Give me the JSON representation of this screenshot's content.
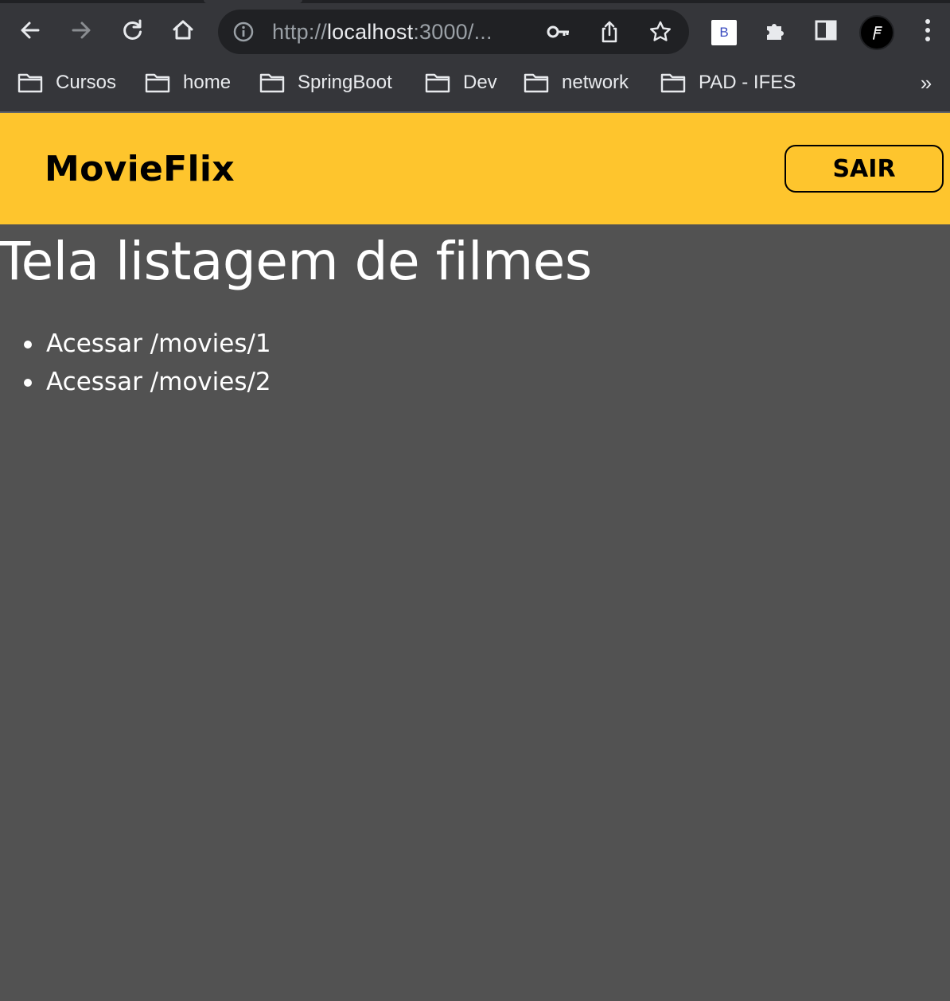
{
  "browser": {
    "url_prefix": "http://",
    "url_host": "localhost",
    "url_rest": ":3000/...",
    "extension_label": "B",
    "icons": {
      "back": "arrow-left-icon",
      "forward": "arrow-right-icon",
      "reload": "reload-icon",
      "home": "home-icon",
      "site_info": "info-icon",
      "password": "key-icon",
      "share": "share-icon",
      "bookmark": "star-icon",
      "extensions": "puzzle-icon",
      "side_panel": "side-panel-icon",
      "menu": "kebab-menu-icon"
    },
    "bookmarks": [
      "Cursos",
      "home",
      "SpringBoot",
      "Dev",
      "network",
      "PAD - IFES"
    ],
    "bookmarks_overflow": "»"
  },
  "header": {
    "brand": "MovieFlix",
    "logout_label": "SAIR",
    "accent_color": "#fec52d"
  },
  "main": {
    "title": "Tela listagem de filmes",
    "links": [
      "Acessar /movies/1",
      "Acessar /movies/2"
    ],
    "background_color": "#525252"
  }
}
